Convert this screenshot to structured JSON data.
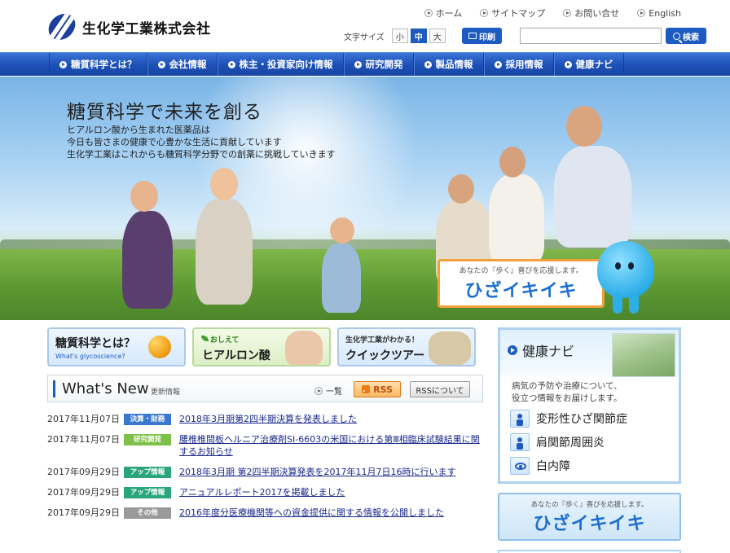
{
  "company": {
    "name": "生化学工業株式会社"
  },
  "utility_nav": [
    {
      "label": "ホーム"
    },
    {
      "label": "サイトマップ"
    },
    {
      "label": "お問い合せ"
    },
    {
      "label": "English"
    }
  ],
  "font_size": {
    "label": "文字サイズ",
    "options": [
      "小",
      "中",
      "大"
    ],
    "selected": "中"
  },
  "print": {
    "label": "印刷"
  },
  "search": {
    "value": "",
    "placeholder": "",
    "button_label": "検索"
  },
  "global_nav": [
    {
      "label": "糖質科学とは？"
    },
    {
      "label": "会社情報"
    },
    {
      "label": "株主・投資家向け情報"
    },
    {
      "label": "研究開発"
    },
    {
      "label": "製品情報"
    },
    {
      "label": "採用情報"
    },
    {
      "label": "健康ナビ"
    }
  ],
  "hero": {
    "title": "糖質科学で未来を創る",
    "lines": [
      "ヒアルロン酸から生まれた医薬品は",
      "今日も皆さまの健康で心豊かな生活に貢献しています",
      "生化学工業はこれからも糖質科学分野での創薬に挑戦していきます"
    ],
    "banner": {
      "top": "あなたの『歩く』喜びを応援します。",
      "main": "ひざイキイキ"
    }
  },
  "cards": [
    {
      "title": "糖質科学とは？",
      "sub": "What's glycoscience?"
    },
    {
      "title": "ヒアルロン酸",
      "sub": "おしえて"
    },
    {
      "title": "クイックツアー",
      "sub": "生化学工業がわかる！"
    }
  ],
  "whats_new": {
    "title": "What's New",
    "subtitle": "更新情報",
    "list_link": "一覧",
    "rss_label": "RSS",
    "rss_about_label": "RSSについて",
    "items": [
      {
        "date": "2017年11月07日",
        "category": "決算・財務",
        "badge_color": "#3a78d0",
        "text": "2018年3月期第2四半期決算を発表しました"
      },
      {
        "date": "2017年11月07日",
        "category": "研究開発",
        "badge_color": "#7fc04a",
        "text": "腰椎椎間板ヘルニア治療剤SI-6603の米国における第Ⅲ相臨床試験結果に関するお知らせ"
      },
      {
        "date": "2017年09月29日",
        "category": "アップ情報",
        "badge_color": "#2aa57a",
        "text": "2018年3月期 第2四半期決算発表を2017年11月7日16時に行います"
      },
      {
        "date": "2017年09月29日",
        "category": "アップ情報",
        "badge_color": "#2aa57a",
        "text": "アニュアルレポート2017を掲載しました"
      },
      {
        "date": "2017年09月29日",
        "category": "その他",
        "badge_color": "#9a9a9a",
        "text": "2016年度分医療機関等への資金提供に関する情報を公開しました"
      }
    ]
  },
  "health_navi": {
    "title": "健康ナビ",
    "description": [
      "病気の予防や治療について、",
      "役立つ情報をお届けします。"
    ],
    "items": [
      {
        "label": "変形性ひざ関節症",
        "icon": "knee-figure-icon"
      },
      {
        "label": "肩関節周囲炎",
        "icon": "shoulder-figure-icon"
      },
      {
        "label": "白内障",
        "icon": "eye-icon"
      }
    ]
  },
  "side_banner": {
    "top": "あなたの『歩く』喜びを応援します。",
    "main": "ひざイキイキ"
  },
  "colors": {
    "brand_blue": "#1d5bc0",
    "nav_blue": "#1c4fb5",
    "link": "#1a2a8c"
  }
}
